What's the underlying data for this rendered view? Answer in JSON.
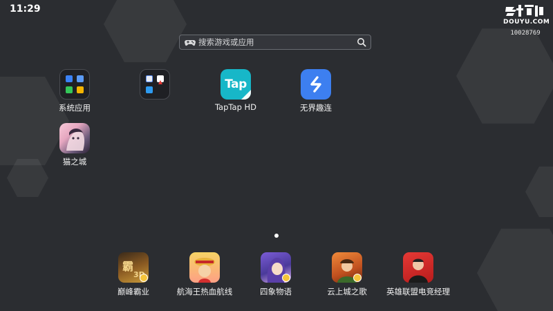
{
  "status_bar": {
    "time": "11:29"
  },
  "brand": {
    "logo_text": "DOUYU.COM",
    "room_id": "10028769"
  },
  "search": {
    "placeholder": "搜索游戏或应用"
  },
  "apps": [
    {
      "label": "系统应用",
      "icon": "folder-icon"
    },
    {
      "label": "",
      "icon": "folder-icon"
    },
    {
      "label": "TapTap HD",
      "icon": "taptap-icon",
      "icon_text": "Tap"
    },
    {
      "label": "无界趣连",
      "icon": "wujie-icon"
    },
    {
      "label": "猫之城",
      "icon": "game-icon"
    }
  ],
  "page_indicator": {
    "current": 1,
    "total": 1
  },
  "dock": [
    {
      "label": "巅峰霸业",
      "icon": "game-icon"
    },
    {
      "label": "航海王热血航线",
      "icon": "game-icon"
    },
    {
      "label": "四象物语",
      "icon": "game-icon"
    },
    {
      "label": "云上城之歌",
      "icon": "game-icon"
    },
    {
      "label": "英雄联盟电竞经理",
      "icon": "game-icon"
    }
  ],
  "colors": {
    "background": "#2b2d31",
    "taptap": "#17b7c8",
    "wujie": "#3d7ff0",
    "badge": "#f5c43a"
  }
}
